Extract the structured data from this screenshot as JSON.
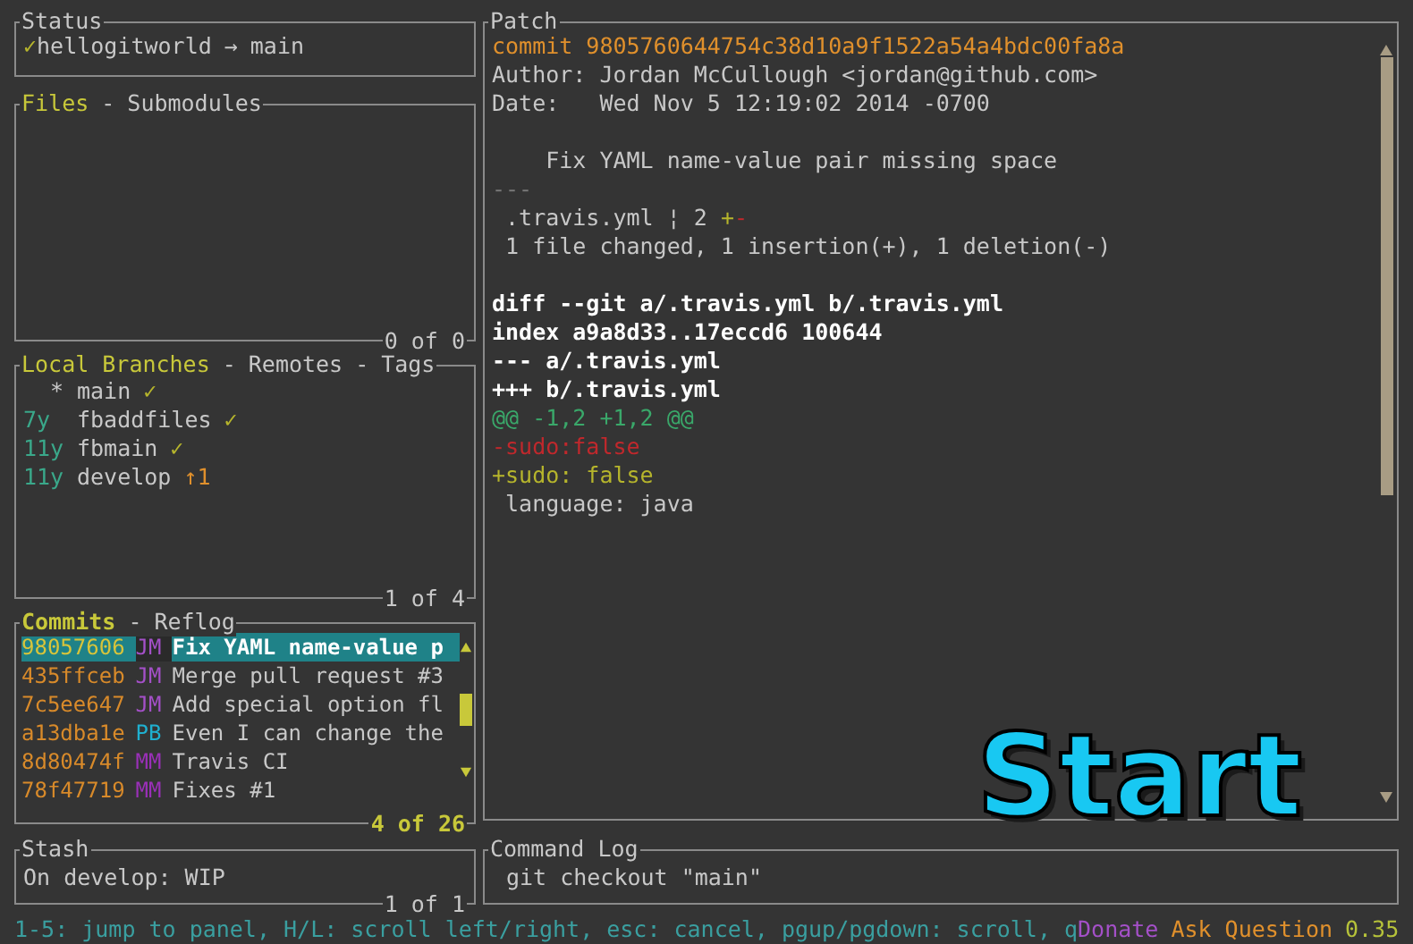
{
  "status": {
    "title": "Status",
    "check": "✓",
    "repo": "hellogitworld",
    "arrow": "→",
    "branch": "main"
  },
  "files": {
    "tabs": [
      {
        "label": "Files",
        "selected": true
      },
      {
        "label": "Submodules",
        "selected": false
      }
    ],
    "separator": "-",
    "count": "0 of 0"
  },
  "branches": {
    "tabs": [
      {
        "label": "Local Branches",
        "selected": true
      },
      {
        "label": "Remotes",
        "selected": false
      },
      {
        "label": "Tags",
        "selected": false
      }
    ],
    "separator": "-",
    "count": "1 of 4",
    "items": [
      {
        "head": "*",
        "name": "main",
        "status": "✓",
        "kind": "synced"
      },
      {
        "age": "7y",
        "name": "fbaddfiles",
        "status": "✓",
        "kind": "synced"
      },
      {
        "age": "11y",
        "name": "fbmain",
        "status": "✓",
        "kind": "synced"
      },
      {
        "age": "11y",
        "name": "develop",
        "status": "↑1",
        "kind": "ahead"
      }
    ]
  },
  "commits": {
    "tabs": [
      {
        "label": "Commits",
        "selected": true
      },
      {
        "label": "Reflog",
        "selected": false
      }
    ],
    "separator": "-",
    "count": "4 of 26",
    "items": [
      {
        "hash": "98057606",
        "author": "JM",
        "color": "#a450c8",
        "message": "Fix YAML name-value p",
        "selected": true
      },
      {
        "hash": "435ffceb",
        "author": "JM",
        "color": "#a450c8",
        "message": "Merge pull request #3",
        "selected": false
      },
      {
        "hash": "7c5ee647",
        "author": "JM",
        "color": "#a450c8",
        "message": "Add special option fl",
        "selected": false
      },
      {
        "hash": "a13dba1e",
        "author": "PB",
        "color": "#1fb0d0",
        "message": "Even I can change the",
        "selected": false
      },
      {
        "hash": "8d80474f",
        "author": "MM",
        "color": "#9a30b8",
        "message": "Travis CI",
        "selected": false
      },
      {
        "hash": "78f47719",
        "author": "MM",
        "color": "#9a30b8",
        "message": "Fixes #1",
        "selected": false
      }
    ]
  },
  "patch": {
    "title": "Patch",
    "lines": [
      {
        "kind": "commit",
        "text": "commit 9805760644754c38d10a9f1522a54a4bdc00fa8a"
      },
      {
        "kind": "plain",
        "text": "Author: Jordan McCullough <jordan@github.com>"
      },
      {
        "kind": "plain",
        "text": "Date:   Wed Nov 5 12:19:02 2014 -0700"
      },
      {
        "kind": "blank"
      },
      {
        "kind": "plain",
        "text": "    Fix YAML name-value pair missing space"
      },
      {
        "kind": "dim",
        "text": "---"
      },
      {
        "kind": "stat",
        "text": " .travis.yml ¦ 2 ",
        "plus": "+",
        "minus": "-"
      },
      {
        "kind": "plain",
        "text": " 1 file changed, 1 insertion(+), 1 deletion(-)"
      },
      {
        "kind": "blank"
      },
      {
        "kind": "header",
        "text": "diff --git a/.travis.yml b/.travis.yml"
      },
      {
        "kind": "header",
        "text": "index a9a8d33..17eccd6 100644"
      },
      {
        "kind": "header",
        "text": "--- a/.travis.yml"
      },
      {
        "kind": "header",
        "text": "+++ b/.travis.yml"
      },
      {
        "kind": "hunk",
        "text": "@@ -1,2 +1,2 @@"
      },
      {
        "kind": "del",
        "text": "-sudo:false"
      },
      {
        "kind": "add",
        "text": "+sudo: false"
      },
      {
        "kind": "plain",
        "text": " language: java"
      }
    ]
  },
  "stash": {
    "title": "Stash",
    "text": "On develop: WIP",
    "count": "1 of 1"
  },
  "command_log": {
    "title": "Command Log",
    "lines": [
      "git checkout \"main\""
    ]
  },
  "status_bar": {
    "keybindings": "1-5: jump to panel, H/L: scroll left/right, esc: cancel, pgup/pgdown: scroll, q",
    "donate": "Donate",
    "ask": "Ask Question",
    "version": "0.35"
  },
  "overlay": {
    "caption": "Start"
  }
}
